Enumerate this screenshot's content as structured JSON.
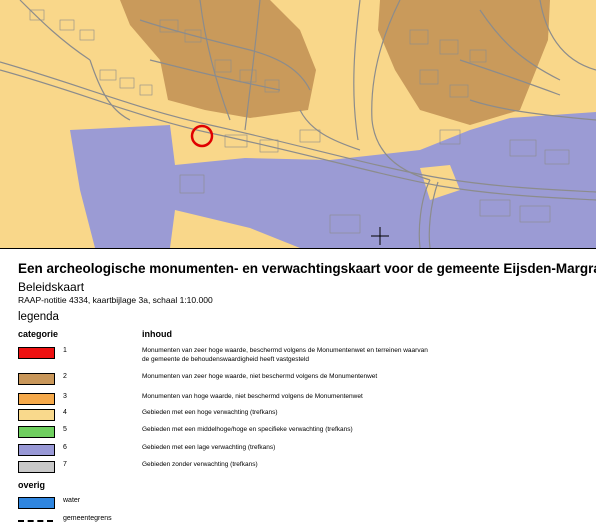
{
  "map": {
    "colors": {
      "cat2": "#c99a5b",
      "cat4": "#f9d78a",
      "cat6": "#9b9bd4",
      "road": "#8c8c8c",
      "marker": "#e00000"
    },
    "crosshair": "plus-icon"
  },
  "legend": {
    "title": "Een archeologische monumenten- en verwachtingskaart voor de gemeente Eijsden-Margraten",
    "subtitle": "Beleidskaart",
    "note": "RAAP-notitie 4334, kaartbijlage 3a, schaal 1:10.000",
    "heading": "legenda",
    "col_category": "categorie",
    "col_content": "inhoud",
    "items": [
      {
        "num": "1",
        "color": "#ee1111",
        "desc": "Monumenten van zeer hoge waarde, beschermd volgens de Monumentenwet en terreinen waarvan de gemeente de behoudenswaardigheid heeft vastgesteld"
      },
      {
        "num": "2",
        "color": "#c9975a",
        "desc": "Monumenten van zeer hoge waarde, niet beschermd volgens de Monumentenwet"
      },
      {
        "num": "3",
        "color": "#f5a94a",
        "desc": "Monumenten van hoge waarde, niet beschermd volgens de Monumentenwet"
      },
      {
        "num": "4",
        "color": "#f9d98c",
        "desc": "Gebieden met een hoge verwachting (trefkans)"
      },
      {
        "num": "5",
        "color": "#6fcf5f",
        "desc": "Gebieden met een middelhoge/hoge en specifieke verwachting (trefkans)"
      },
      {
        "num": "6",
        "color": "#9999d6",
        "desc": "Gebieden met een lage verwachting (trefkans)"
      },
      {
        "num": "7",
        "color": "#c8c8c8",
        "desc": "Gebieden zonder verwachting (trefkans)"
      }
    ],
    "overig_label": "overig",
    "other": [
      {
        "label": "water",
        "color": "#2f86e0"
      },
      {
        "label": "gemeentegrens"
      }
    ]
  }
}
